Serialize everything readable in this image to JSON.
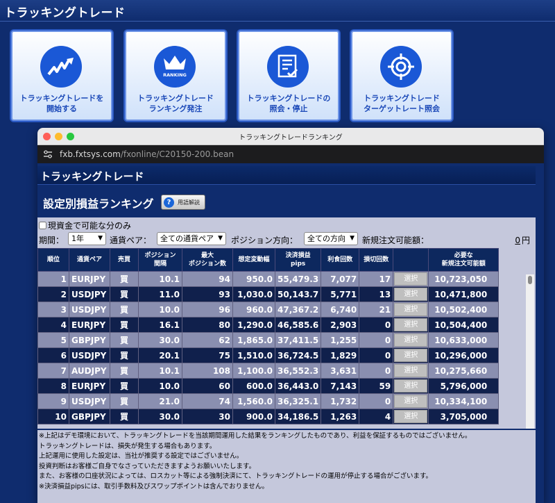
{
  "header": {
    "title": "トラッキングトレード"
  },
  "menu": [
    {
      "label": "トラッキングトレードを\n開始する",
      "icon": "trend-chart-icon"
    },
    {
      "label": "トラッキングトレード\nランキング発注",
      "icon": "ranking-crown-icon",
      "badge": "RANKING"
    },
    {
      "label": "トラッキングトレードの\n照会・停止",
      "icon": "document-list-icon"
    },
    {
      "label": "トラッキングトレード\nターゲットレート照会",
      "icon": "target-icon"
    }
  ],
  "browser": {
    "title": "トラッキングトレードランキング",
    "url_host": "fxb.fxtsys.com",
    "url_path": "/fxonline/C20150-200.bean"
  },
  "page": {
    "bar_title": "トラッキングトレード",
    "section_title": "設定別損益ランキング",
    "help_button": "用語解説"
  },
  "filters": {
    "checkbox_label": "現資金で可能な分のみ",
    "period_label": "期間：",
    "period_value": "1年",
    "pair_label": "通貨ペア：",
    "pair_value": "全ての通貨ペア",
    "direction_label": "ポジション方向：",
    "direction_value": "全ての方向",
    "available_label": "新規注文可能額：",
    "available_value": "0",
    "available_unit": "円"
  },
  "table": {
    "headers": [
      "順位",
      "通貨ペア",
      "売買",
      "ポジション\n間隔",
      "最大\nポジション数",
      "想定変動幅",
      "決済損益\npips",
      "利食回数",
      "損切回数",
      "",
      "必要な\n新規注文可能額"
    ],
    "select_label": "選択",
    "rows": [
      [
        "1",
        "EURJPY",
        "買",
        "10.1",
        "94",
        "950.0",
        "55,479.3",
        "7,077",
        "17",
        "10,723,050"
      ],
      [
        "2",
        "USDJPY",
        "買",
        "11.0",
        "93",
        "1,030.0",
        "50,143.7",
        "5,771",
        "13",
        "10,471,800"
      ],
      [
        "3",
        "USDJPY",
        "買",
        "10.0",
        "96",
        "960.0",
        "47,367.2",
        "6,740",
        "21",
        "10,502,400"
      ],
      [
        "4",
        "EURJPY",
        "買",
        "16.1",
        "80",
        "1,290.0",
        "46,585.6",
        "2,903",
        "0",
        "10,504,400"
      ],
      [
        "5",
        "GBPJPY",
        "買",
        "30.0",
        "62",
        "1,865.0",
        "37,411.5",
        "1,255",
        "0",
        "10,633,000"
      ],
      [
        "6",
        "USDJPY",
        "買",
        "20.1",
        "75",
        "1,510.0",
        "36,724.5",
        "1,829",
        "0",
        "10,296,000"
      ],
      [
        "7",
        "AUDJPY",
        "買",
        "10.1",
        "108",
        "1,100.0",
        "36,552.3",
        "3,631",
        "0",
        "10,275,660"
      ],
      [
        "8",
        "EURJPY",
        "買",
        "10.0",
        "60",
        "600.0",
        "36,443.0",
        "7,143",
        "59",
        "5,796,000"
      ],
      [
        "9",
        "USDJPY",
        "買",
        "21.0",
        "74",
        "1,560.0",
        "36,325.1",
        "1,732",
        "0",
        "10,334,100"
      ],
      [
        "10",
        "GBPJPY",
        "買",
        "30.0",
        "30",
        "900.0",
        "34,186.5",
        "1,263",
        "4",
        "3,705,000"
      ]
    ]
  },
  "notes": [
    "※上記はデモ環境において、トラッキングトレードを当該期間運用した結果をランキングしたものであり、利益を保証するものではございません。",
    "トラッキングトレードは、損失が発生する場合もあります。",
    "上記運用に使用した設定は、当社が推奨する設定ではございません。",
    "投資判断はお客様ご自身でなさっていただきますようお願いいたします。",
    "また、お客様の口座状況によっては、ロスカット等による強制決済にて、トラッキングトレードの運用が停止する場合がございます。",
    "※決済損益pipsには、取引手数料及びスワップポイントは含んでおりません。"
  ]
}
